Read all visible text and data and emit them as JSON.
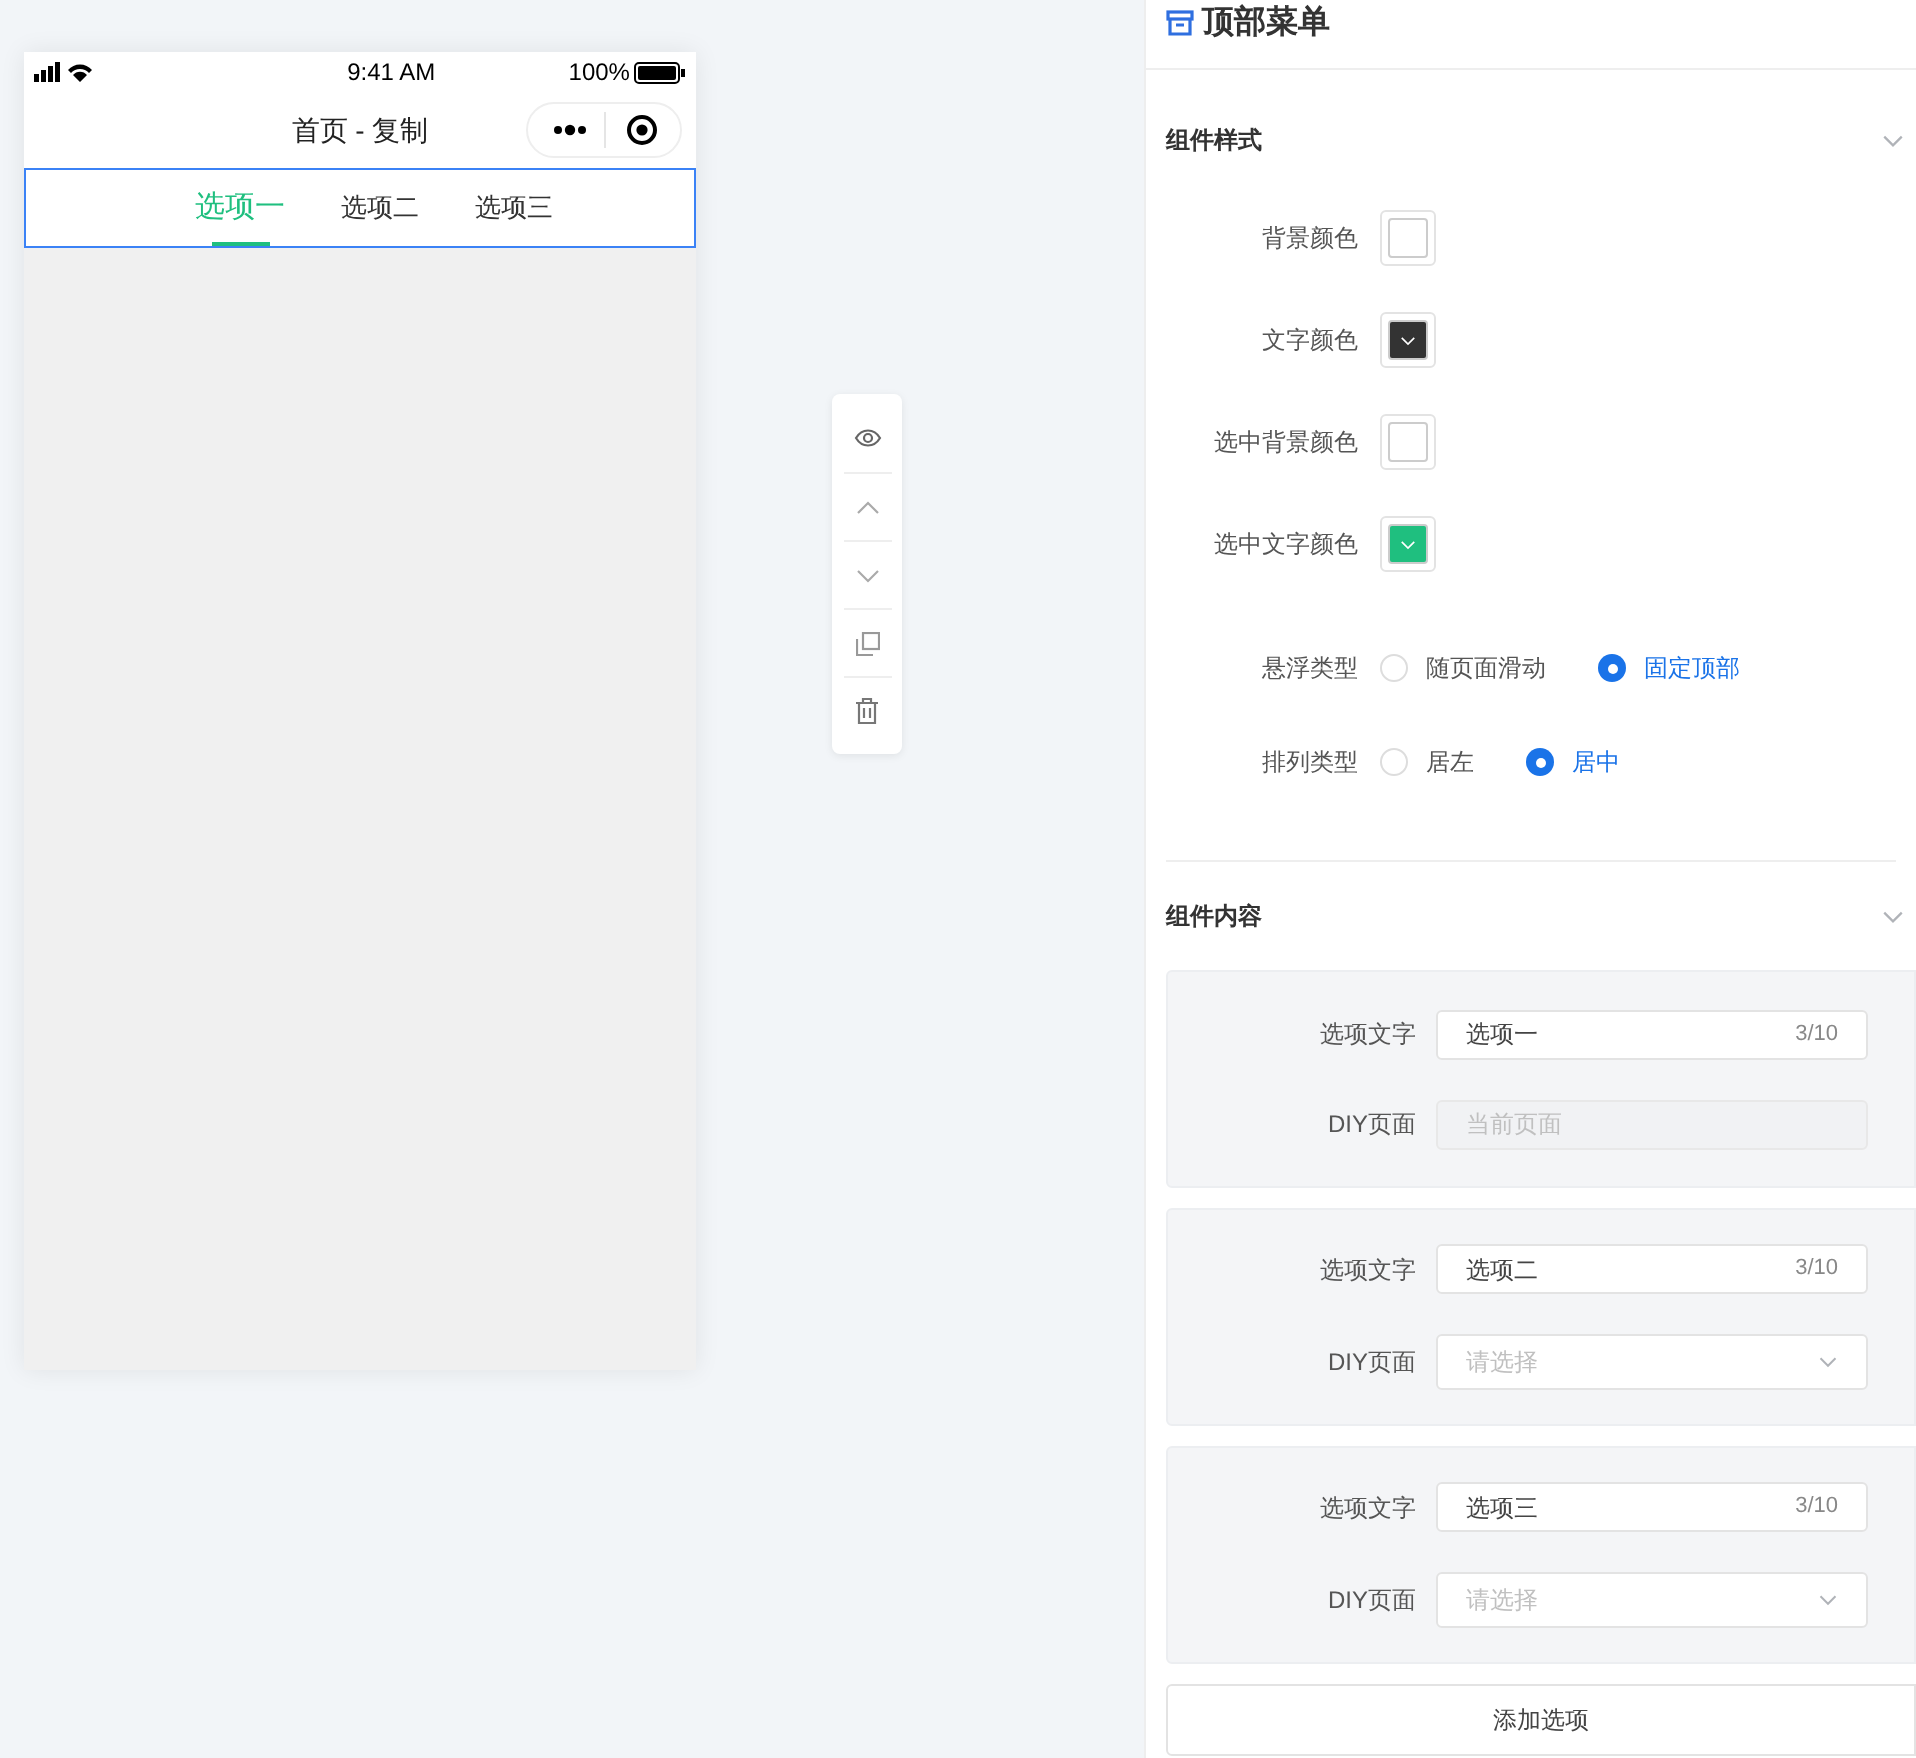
{
  "phone": {
    "status_bar": {
      "time": "9:41 AM",
      "battery": "100%"
    },
    "title": "首页 - 复制",
    "tabs": [
      {
        "label": "选项一",
        "selected": true
      },
      {
        "label": "选项二",
        "selected": false
      },
      {
        "label": "选项三",
        "selected": false
      }
    ]
  },
  "panel": {
    "title": "顶部菜单",
    "style_section": {
      "title": "组件样式",
      "colors": [
        {
          "label": "背景颜色",
          "color": "#ffffff"
        },
        {
          "label": "文字颜色",
          "color": "#333333"
        },
        {
          "label": "选中背景颜色",
          "color": "#ffffff"
        },
        {
          "label": "选中文字颜色",
          "color": "#1fbf7f"
        }
      ],
      "radios": [
        {
          "label": "悬浮类型",
          "options": [
            {
              "label": "随页面滑动",
              "selected": false
            },
            {
              "label": "固定顶部",
              "selected": true
            }
          ]
        },
        {
          "label": "排列类型",
          "options": [
            {
              "label": "居左",
              "selected": false
            },
            {
              "label": "居中",
              "selected": true
            }
          ]
        }
      ]
    },
    "content_section": {
      "title": "组件内容",
      "items": [
        {
          "text_label": "选项文字",
          "text_value": "选项一",
          "counter": "3/10",
          "page_label": "DIY页面",
          "page_placeholder": "当前页面",
          "page_disabled": true
        },
        {
          "text_label": "选项文字",
          "text_value": "选项二",
          "counter": "3/10",
          "page_label": "DIY页面",
          "page_placeholder": "请选择",
          "page_disabled": false
        },
        {
          "text_label": "选项文字",
          "text_value": "选项三",
          "counter": "3/10",
          "page_label": "DIY页面",
          "page_placeholder": "请选择",
          "page_disabled": false
        }
      ],
      "add_button": "添加选项"
    }
  }
}
